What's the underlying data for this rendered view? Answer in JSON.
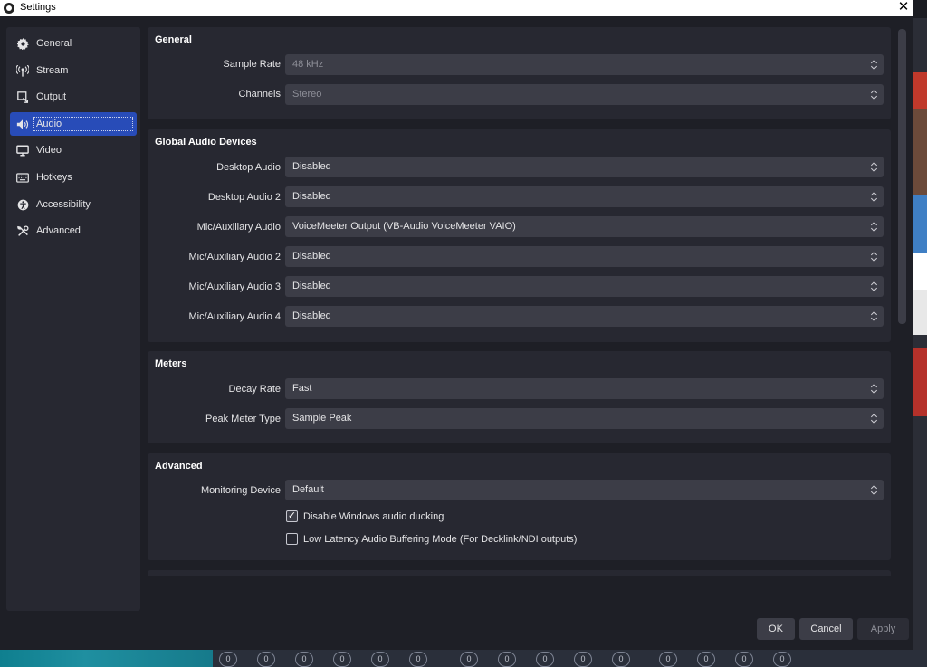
{
  "window": {
    "title": "Settings"
  },
  "sidebar": {
    "items": [
      {
        "label": "General",
        "icon": "gear-icon"
      },
      {
        "label": "Stream",
        "icon": "antenna-icon"
      },
      {
        "label": "Output",
        "icon": "output-icon"
      },
      {
        "label": "Audio",
        "icon": "speaker-icon",
        "active": true
      },
      {
        "label": "Video",
        "icon": "monitor-icon"
      },
      {
        "label": "Hotkeys",
        "icon": "keyboard-icon"
      },
      {
        "label": "Accessibility",
        "icon": "accessibility-icon"
      },
      {
        "label": "Advanced",
        "icon": "tools-icon"
      }
    ]
  },
  "general": {
    "title": "General",
    "sample_rate_label": "Sample Rate",
    "sample_rate_value": "48 kHz",
    "channels_label": "Channels",
    "channels_value": "Stereo"
  },
  "devices": {
    "title": "Global Audio Devices",
    "rows": [
      {
        "label": "Desktop Audio",
        "value": "Disabled"
      },
      {
        "label": "Desktop Audio 2",
        "value": "Disabled"
      },
      {
        "label": "Mic/Auxiliary Audio",
        "value": "VoiceMeeter Output (VB-Audio VoiceMeeter VAIO)"
      },
      {
        "label": "Mic/Auxiliary Audio 2",
        "value": "Disabled"
      },
      {
        "label": "Mic/Auxiliary Audio 3",
        "value": "Disabled"
      },
      {
        "label": "Mic/Auxiliary Audio 4",
        "value": "Disabled"
      }
    ]
  },
  "meters": {
    "title": "Meters",
    "decay_label": "Decay Rate",
    "decay_value": "Fast",
    "peak_label": "Peak Meter Type",
    "peak_value": "Sample Peak"
  },
  "advanced": {
    "title": "Advanced",
    "monitoring_label": "Monitoring Device",
    "monitoring_value": "Default",
    "ducking_label": "Disable Windows audio ducking",
    "ducking_checked": true,
    "latency_label": "Low Latency Audio Buffering Mode (For Decklink/NDI outputs)",
    "latency_checked": false
  },
  "buttons": {
    "ok": "OK",
    "cancel": "Cancel",
    "apply": "Apply"
  },
  "colors": {
    "accent": "#284cb8",
    "panel": "#272831",
    "background": "#1e1f26",
    "input": "#3c3d47"
  }
}
